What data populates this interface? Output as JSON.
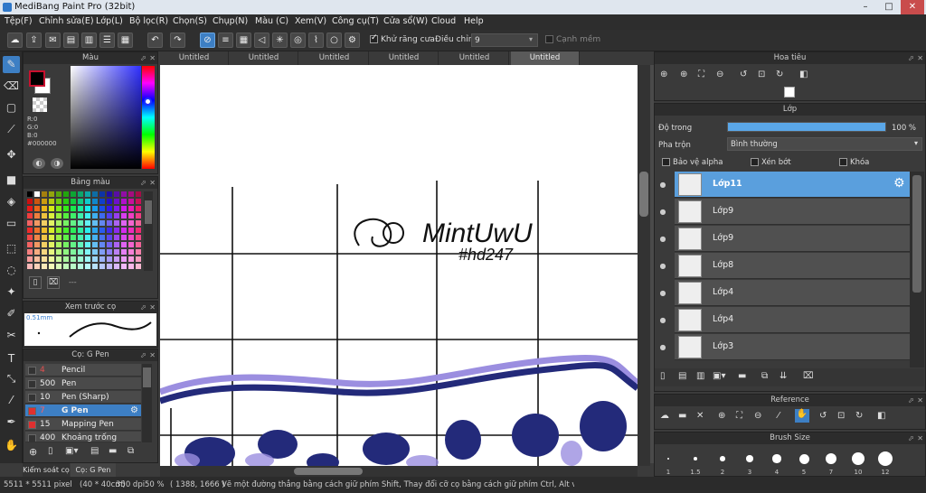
{
  "window": {
    "title": "MediBang Paint Pro (32bit)"
  },
  "menu": [
    "Tệp(F)",
    "Chỉnh sửa(E)",
    "Lớp(L)",
    "Bộ lọc(R)",
    "Chọn(S)",
    "Chụp(N)",
    "Màu (C)",
    "Xem(V)",
    "Công cụ(T)",
    "Cửa sổ(W)",
    "Cloud",
    "Help"
  ],
  "toolbar": {
    "antialias_label": "Khử răng cưa",
    "correction_label": "Điều chỉnh",
    "correction_value": "9",
    "sharp_edges_label": "Cạnh mềm"
  },
  "color_panel": {
    "title": "Màu",
    "r": "R:0",
    "g": "G:0",
    "b": "B:0",
    "hex": "#000000",
    "fg_color": "#000000",
    "accent": "#c8102e"
  },
  "palette_panel": {
    "title": "Bảng màu",
    "footer_label": "---"
  },
  "preview_panel": {
    "title": "Xem trước cọ",
    "size": "0.51mm"
  },
  "brush_panel": {
    "title": "Cọ: G Pen",
    "brushes": [
      {
        "size": "4",
        "name": "Pencil",
        "color": "#333333"
      },
      {
        "size": "500",
        "name": "Pen",
        "color": "#333333"
      },
      {
        "size": "10",
        "name": "Pen (Sharp)",
        "color": "#333333"
      },
      {
        "size": "7",
        "name": "G Pen",
        "color": "#e03030"
      },
      {
        "size": "15",
        "name": "Mapping Pen",
        "color": "#e03030"
      },
      {
        "size": "400",
        "name": "Khoảng trống [Edge",
        "color": "#333333"
      }
    ]
  },
  "bottom_left_tabs": [
    "Kiểm soát cọ",
    "Cọ: G Pen"
  ],
  "tabs": [
    "Untitled",
    "Untitled",
    "Untitled",
    "Untitled",
    "Untitled",
    "Untitled"
  ],
  "canvas_text": {
    "line1": "MintUwU",
    "line2": "#hd247"
  },
  "navigator_panel": {
    "title": "Hoa tiêu"
  },
  "layer_panel": {
    "title": "Lớp",
    "opacity_label": "Độ trong",
    "opacity_value": "100 %",
    "opacity_fraction": 1.0,
    "blend_label": "Pha trộn",
    "blend_value": "Bình thường",
    "protect_alpha": "Bảo vệ alpha",
    "clipping": "Xén bớt",
    "lock": "Khóa",
    "layers": [
      "Lớp11",
      "Lớp9",
      "Lớp9",
      "Lớp8",
      "Lớp4",
      "Lớp4",
      "Lớp3"
    ]
  },
  "reference_panel": {
    "title": "Reference"
  },
  "brush_size_panel": {
    "title": "Brush Size",
    "sizes": [
      "1",
      "1.5",
      "2",
      "3",
      "4",
      "5",
      "7",
      "10",
      "12"
    ]
  },
  "status": {
    "dims": "5511 * 5511 pixel",
    "cm": "(40 * 40cm)",
    "dpi": "350 dpi",
    "zoom": "50 %",
    "coords": "( 1388, 1666 )",
    "hint": "Vẽ một đường thẳng bằng cách giữ phím Shift, Thay đổi cỡ cọ bằng cách giữ phím Ctrl, Alt và kéo"
  }
}
